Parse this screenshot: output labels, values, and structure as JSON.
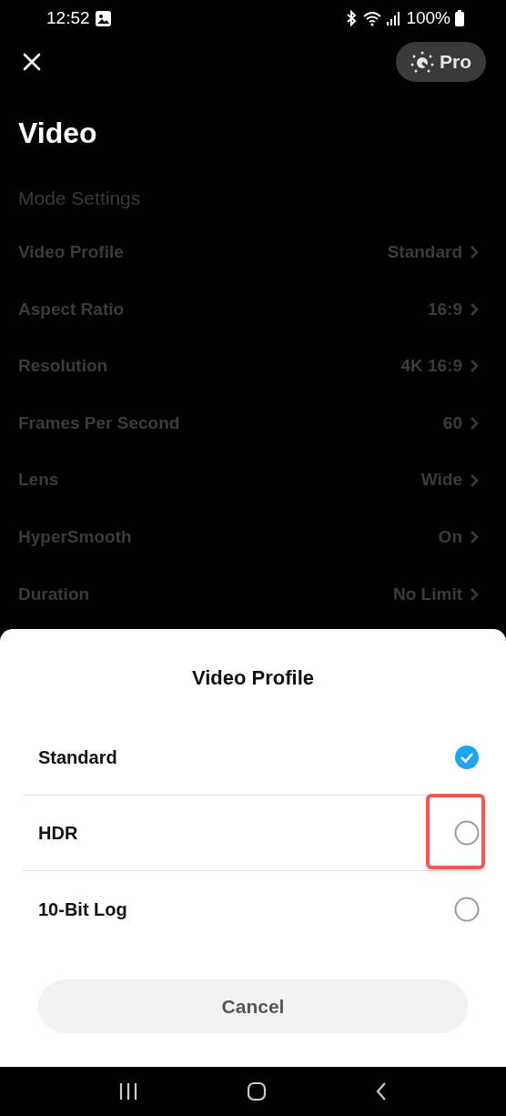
{
  "status_bar": {
    "time": "12:52",
    "battery": "100%"
  },
  "header": {
    "pro_label": "Pro"
  },
  "title": "Video",
  "section": "Mode Settings",
  "settings": [
    {
      "label": "Video Profile",
      "value": "Standard"
    },
    {
      "label": "Aspect Ratio",
      "value": "16:9"
    },
    {
      "label": "Resolution",
      "value": "4K 16:9"
    },
    {
      "label": "Frames Per Second",
      "value": "60"
    },
    {
      "label": "Lens",
      "value": "Wide"
    },
    {
      "label": "HyperSmooth",
      "value": "On"
    },
    {
      "label": "Duration",
      "value": "No Limit"
    }
  ],
  "sheet": {
    "title": "Video Profile",
    "options": [
      {
        "label": "Standard",
        "selected": true,
        "highlighted": false
      },
      {
        "label": "HDR",
        "selected": false,
        "highlighted": true
      },
      {
        "label": "10-Bit Log",
        "selected": false,
        "highlighted": false
      }
    ],
    "cancel": "Cancel"
  }
}
